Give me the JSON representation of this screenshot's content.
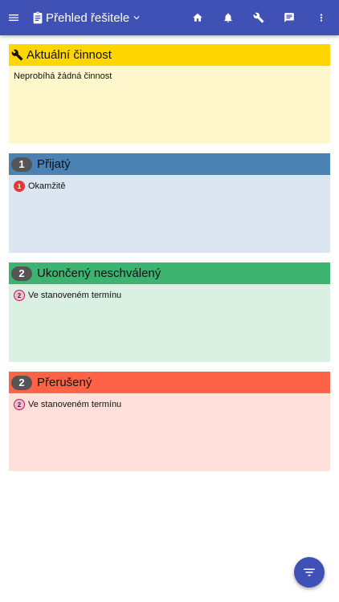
{
  "appbar": {
    "title": "Přehled řešitele",
    "icons": [
      "menu-icon",
      "clipboard-icon",
      "chevron-down-icon",
      "home-icon",
      "bell-icon",
      "wrench-icon",
      "message-icon",
      "more-vert-icon"
    ]
  },
  "current": {
    "title": "Aktuální činnost",
    "message": "Neprobíhá žádná činnost",
    "head_color": "#ffd600",
    "body_color": "#fff8cc"
  },
  "sections": [
    {
      "title": "Přijatý",
      "count": "1",
      "head_color": "#4a82b4",
      "body_color": "#dbe6f0",
      "item": {
        "badge": "1",
        "label": "Okamžitě",
        "badge_color": "#e53935"
      }
    },
    {
      "title": "Ukončený neschválený",
      "count": "2",
      "head_color": "#3cb371",
      "body_color": "#d9f0e3",
      "item": {
        "badge": "2",
        "label": "Ve stanoveném termínu",
        "badge_color": "#f8bbd0"
      }
    },
    {
      "title": "Přerušený",
      "count": "2",
      "head_color": "#ff6347",
      "body_color": "#ffe0da",
      "item": {
        "badge": "2",
        "label": "Ve stanoveném termínu",
        "badge_color": "#f8bbd0"
      }
    }
  ],
  "fab": {
    "icon": "filter-icon"
  }
}
